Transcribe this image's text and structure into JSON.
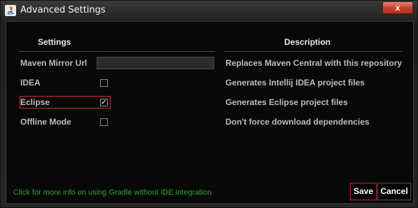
{
  "window": {
    "title": "Advanced Settings",
    "close_label": "x"
  },
  "headers": {
    "settings": "Settings",
    "description": "Description"
  },
  "rows": [
    {
      "label": "Maven Mirror Url",
      "description": "Replaces Maven Central with this repository",
      "control": "text",
      "value": ""
    },
    {
      "label": "IDEA",
      "description": "Generates Intellij IDEA project files",
      "control": "checkbox",
      "checked": false
    },
    {
      "label": "Eclipse",
      "description": "Generates Eclipse project files",
      "control": "checkbox",
      "checked": true
    },
    {
      "label": "Offline Mode",
      "description": "Don't force download dependencies",
      "control": "checkbox",
      "checked": false
    }
  ],
  "footer": {
    "info_link": "Click for more info on using Gradle without IDE integration",
    "save_label": "Save",
    "cancel_label": "Cancel"
  },
  "colors": {
    "focus_border": "#c8282e",
    "link_green": "#2fa32f",
    "close_red": "#c4412f"
  }
}
